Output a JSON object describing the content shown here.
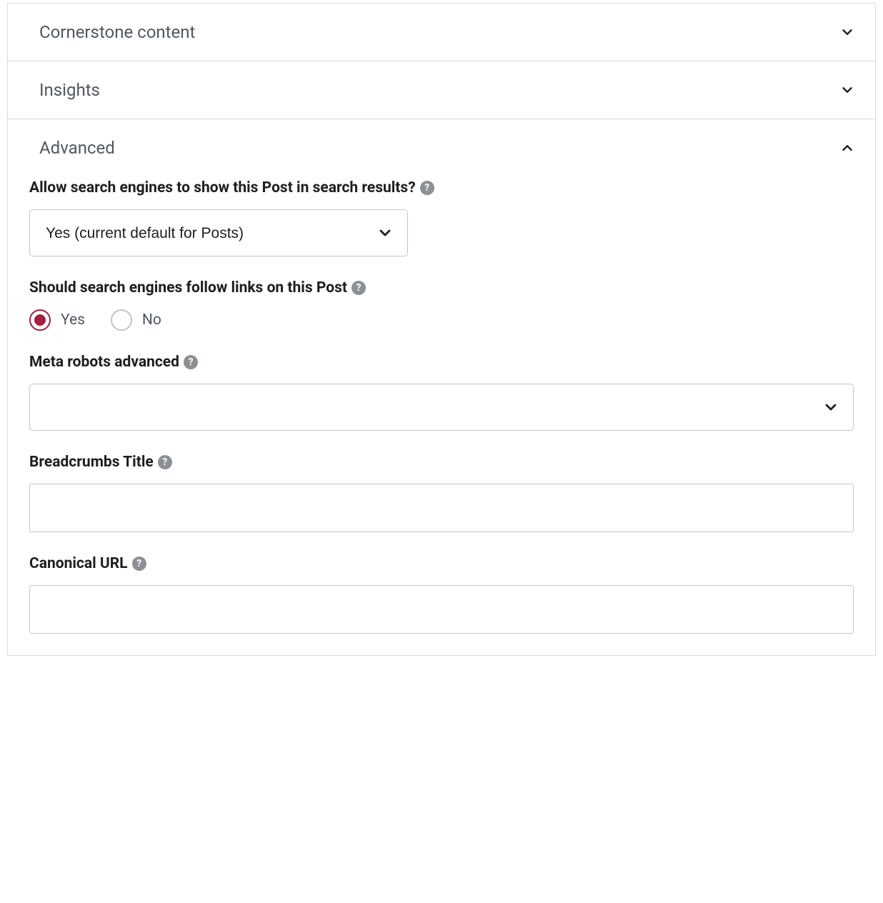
{
  "sections": {
    "cornerstone": {
      "title": "Cornerstone content"
    },
    "insights": {
      "title": "Insights"
    },
    "advanced": {
      "title": "Advanced"
    }
  },
  "advanced": {
    "allow_search": {
      "label": "Allow search engines to show this Post in search results?",
      "selected": "Yes (current default for Posts)"
    },
    "follow_links": {
      "label": "Should search engines follow links on this Post",
      "yes": "Yes",
      "no": "No",
      "value": "yes"
    },
    "meta_robots": {
      "label": "Meta robots advanced",
      "selected": ""
    },
    "breadcrumbs": {
      "label": "Breadcrumbs Title",
      "value": ""
    },
    "canonical": {
      "label": "Canonical URL",
      "value": ""
    }
  }
}
